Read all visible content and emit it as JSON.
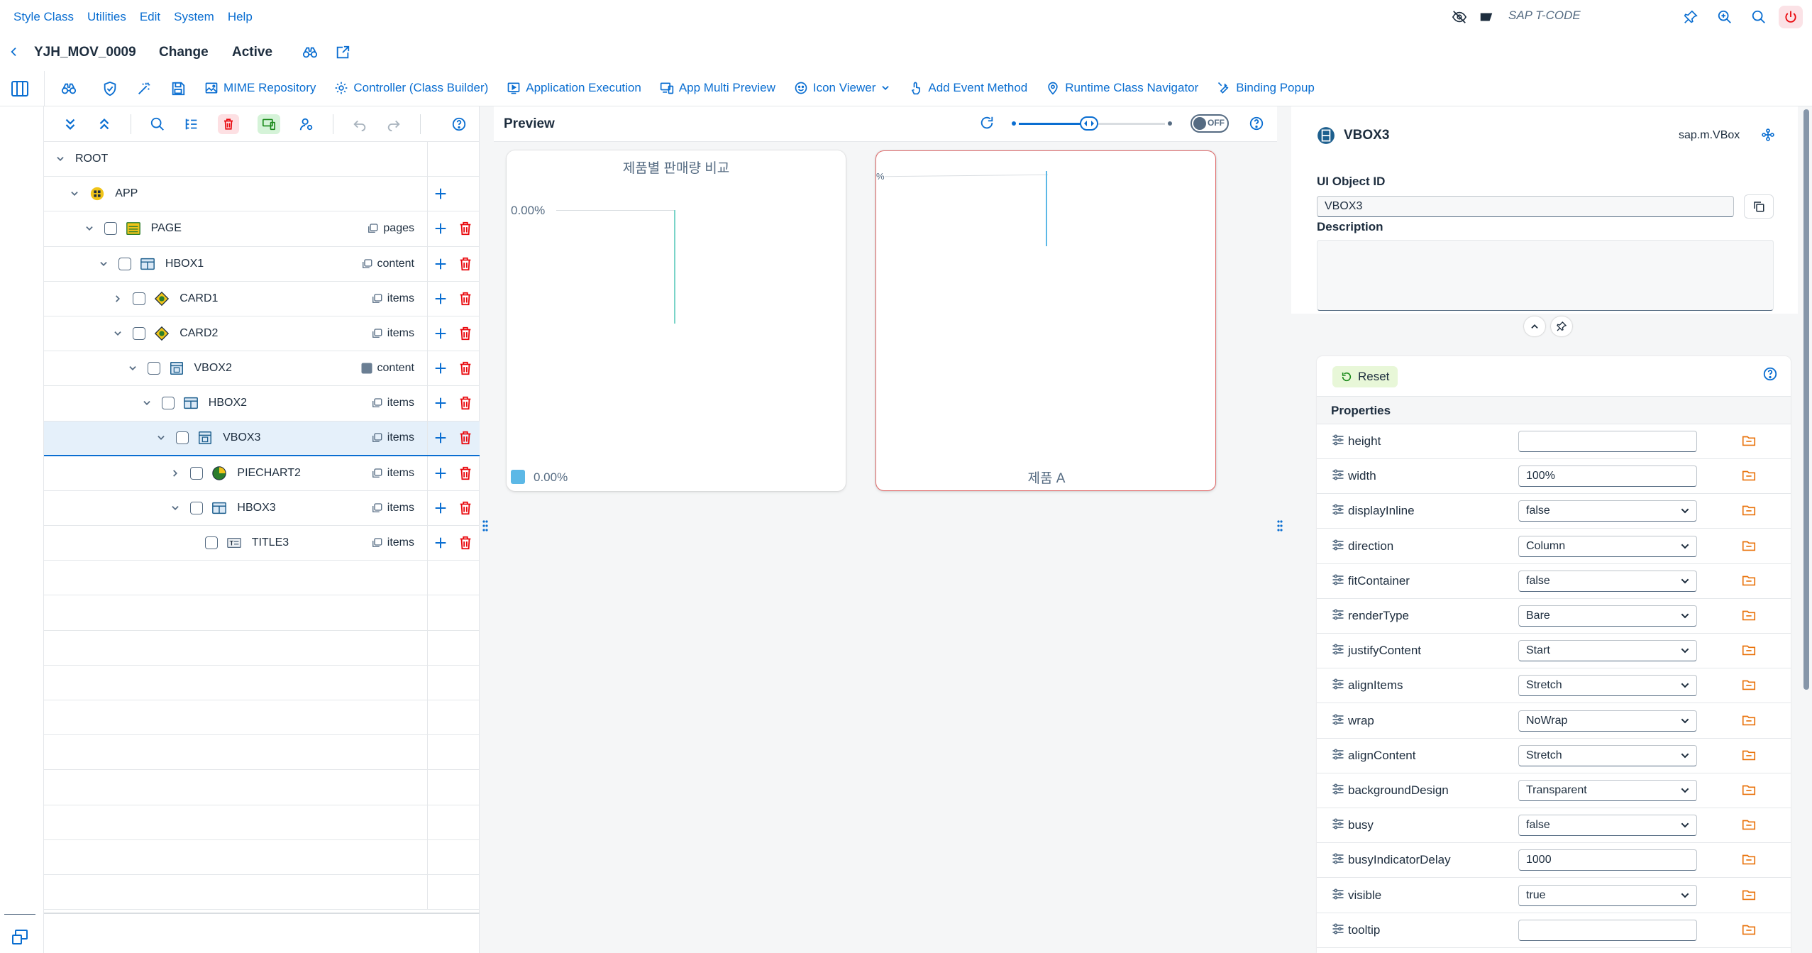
{
  "menu": {
    "items": [
      "Style Class",
      "Utilities",
      "Edit",
      "System",
      "Help"
    ],
    "tcode_placeholder": "SAP T-CODE"
  },
  "header": {
    "app_name": "YJH_MOV_0009",
    "mode": "Change",
    "status": "Active"
  },
  "toolbar": {
    "buttons": [
      {
        "label": "MIME Repository",
        "icon": "image-icon"
      },
      {
        "label": "Controller (Class Builder)",
        "icon": "gear-icon"
      },
      {
        "label": "Application Execution",
        "icon": "execute-icon"
      },
      {
        "label": "App Multi Preview",
        "icon": "devices-icon"
      },
      {
        "label": "Icon Viewer",
        "icon": "smiley-icon"
      },
      {
        "label": "Add Event Method",
        "icon": "touch-icon"
      },
      {
        "label": "Runtime Class Navigator",
        "icon": "location-icon"
      },
      {
        "label": "Binding Popup",
        "icon": "wrench-icon"
      }
    ]
  },
  "tree": {
    "rows": [
      {
        "name": "ROOT",
        "depth": 0,
        "expanded": true,
        "checkbox": false,
        "icon": "",
        "aggregation": "",
        "add": false,
        "del": false
      },
      {
        "name": "APP",
        "depth": 1,
        "expanded": true,
        "checkbox": false,
        "icon": "app-icon",
        "aggregation": "",
        "add": true,
        "del": false
      },
      {
        "name": "PAGE",
        "depth": 2,
        "expanded": true,
        "checkbox": true,
        "icon": "page-icon",
        "aggregation": "pages",
        "add": true,
        "del": true
      },
      {
        "name": "HBOX1",
        "depth": 3,
        "expanded": true,
        "checkbox": true,
        "icon": "hbox-icon",
        "aggregation": "content",
        "add": true,
        "del": true
      },
      {
        "name": "CARD1",
        "depth": 4,
        "expanded": false,
        "checkbox": true,
        "icon": "card-icon",
        "aggregation": "items",
        "add": true,
        "del": true
      },
      {
        "name": "CARD2",
        "depth": 4,
        "expanded": true,
        "checkbox": true,
        "icon": "card-icon",
        "aggregation": "items",
        "add": true,
        "del": true
      },
      {
        "name": "VBOX2",
        "depth": 5,
        "expanded": true,
        "checkbox": true,
        "icon": "vbox-icon",
        "aggregation": "content",
        "add": true,
        "del": true
      },
      {
        "name": "HBOX2",
        "depth": 6,
        "expanded": true,
        "checkbox": true,
        "icon": "hbox-icon",
        "aggregation": "items",
        "add": true,
        "del": true
      },
      {
        "name": "VBOX3",
        "depth": 7,
        "expanded": true,
        "checkbox": true,
        "icon": "vbox-icon",
        "aggregation": "items",
        "add": true,
        "del": true,
        "selected": true
      },
      {
        "name": "PIECHART2",
        "depth": 8,
        "expanded": false,
        "checkbox": true,
        "icon": "piechart-icon",
        "aggregation": "items",
        "add": true,
        "del": true
      },
      {
        "name": "HBOX3",
        "depth": 8,
        "expanded": true,
        "checkbox": true,
        "icon": "hbox-icon",
        "aggregation": "items",
        "add": true,
        "del": true
      },
      {
        "name": "TITLE3",
        "depth": 9,
        "expanded": null,
        "checkbox": true,
        "icon": "title-icon",
        "aggregation": "items",
        "add": true,
        "del": true
      }
    ],
    "empty_rows": 10
  },
  "preview": {
    "title": "Preview",
    "toggle": "OFF",
    "slider_value": 0.48,
    "card1": {
      "title": "제품별 판매량 비교",
      "y_label": "0.00%",
      "legend_label": "0.00%",
      "legend_color": "#5cb8e6"
    },
    "card2": {
      "y_label": "%",
      "title": "제품 A"
    }
  },
  "properties": {
    "object_name": "VBOX3",
    "object_class": "sap.m.VBox",
    "ui_object_id_label": "UI Object ID",
    "ui_object_id": "VBOX3",
    "description_label": "Description",
    "reset_label": "Reset",
    "section_title": "Properties",
    "rows": [
      {
        "name": "height",
        "value": "",
        "type": "input"
      },
      {
        "name": "width",
        "value": "100%",
        "type": "input"
      },
      {
        "name": "displayInline",
        "value": "false",
        "type": "select"
      },
      {
        "name": "direction",
        "value": "Column",
        "type": "select"
      },
      {
        "name": "fitContainer",
        "value": "false",
        "type": "select"
      },
      {
        "name": "renderType",
        "value": "Bare",
        "type": "select"
      },
      {
        "name": "justifyContent",
        "value": "Start",
        "type": "select"
      },
      {
        "name": "alignItems",
        "value": "Stretch",
        "type": "select"
      },
      {
        "name": "wrap",
        "value": "NoWrap",
        "type": "select"
      },
      {
        "name": "alignContent",
        "value": "Stretch",
        "type": "select"
      },
      {
        "name": "backgroundDesign",
        "value": "Transparent",
        "type": "select"
      },
      {
        "name": "busy",
        "value": "false",
        "type": "select"
      },
      {
        "name": "busyIndicatorDelay",
        "value": "1000",
        "type": "input"
      },
      {
        "name": "visible",
        "value": "true",
        "type": "select"
      },
      {
        "name": "tooltip",
        "value": "",
        "type": "input"
      }
    ]
  },
  "colors": {
    "accent": "#0a6ed1",
    "delete": "#e9070c",
    "binding": "#e9730c",
    "card2_border": "#e06a6a",
    "power_bg": "#fbe2e6"
  }
}
